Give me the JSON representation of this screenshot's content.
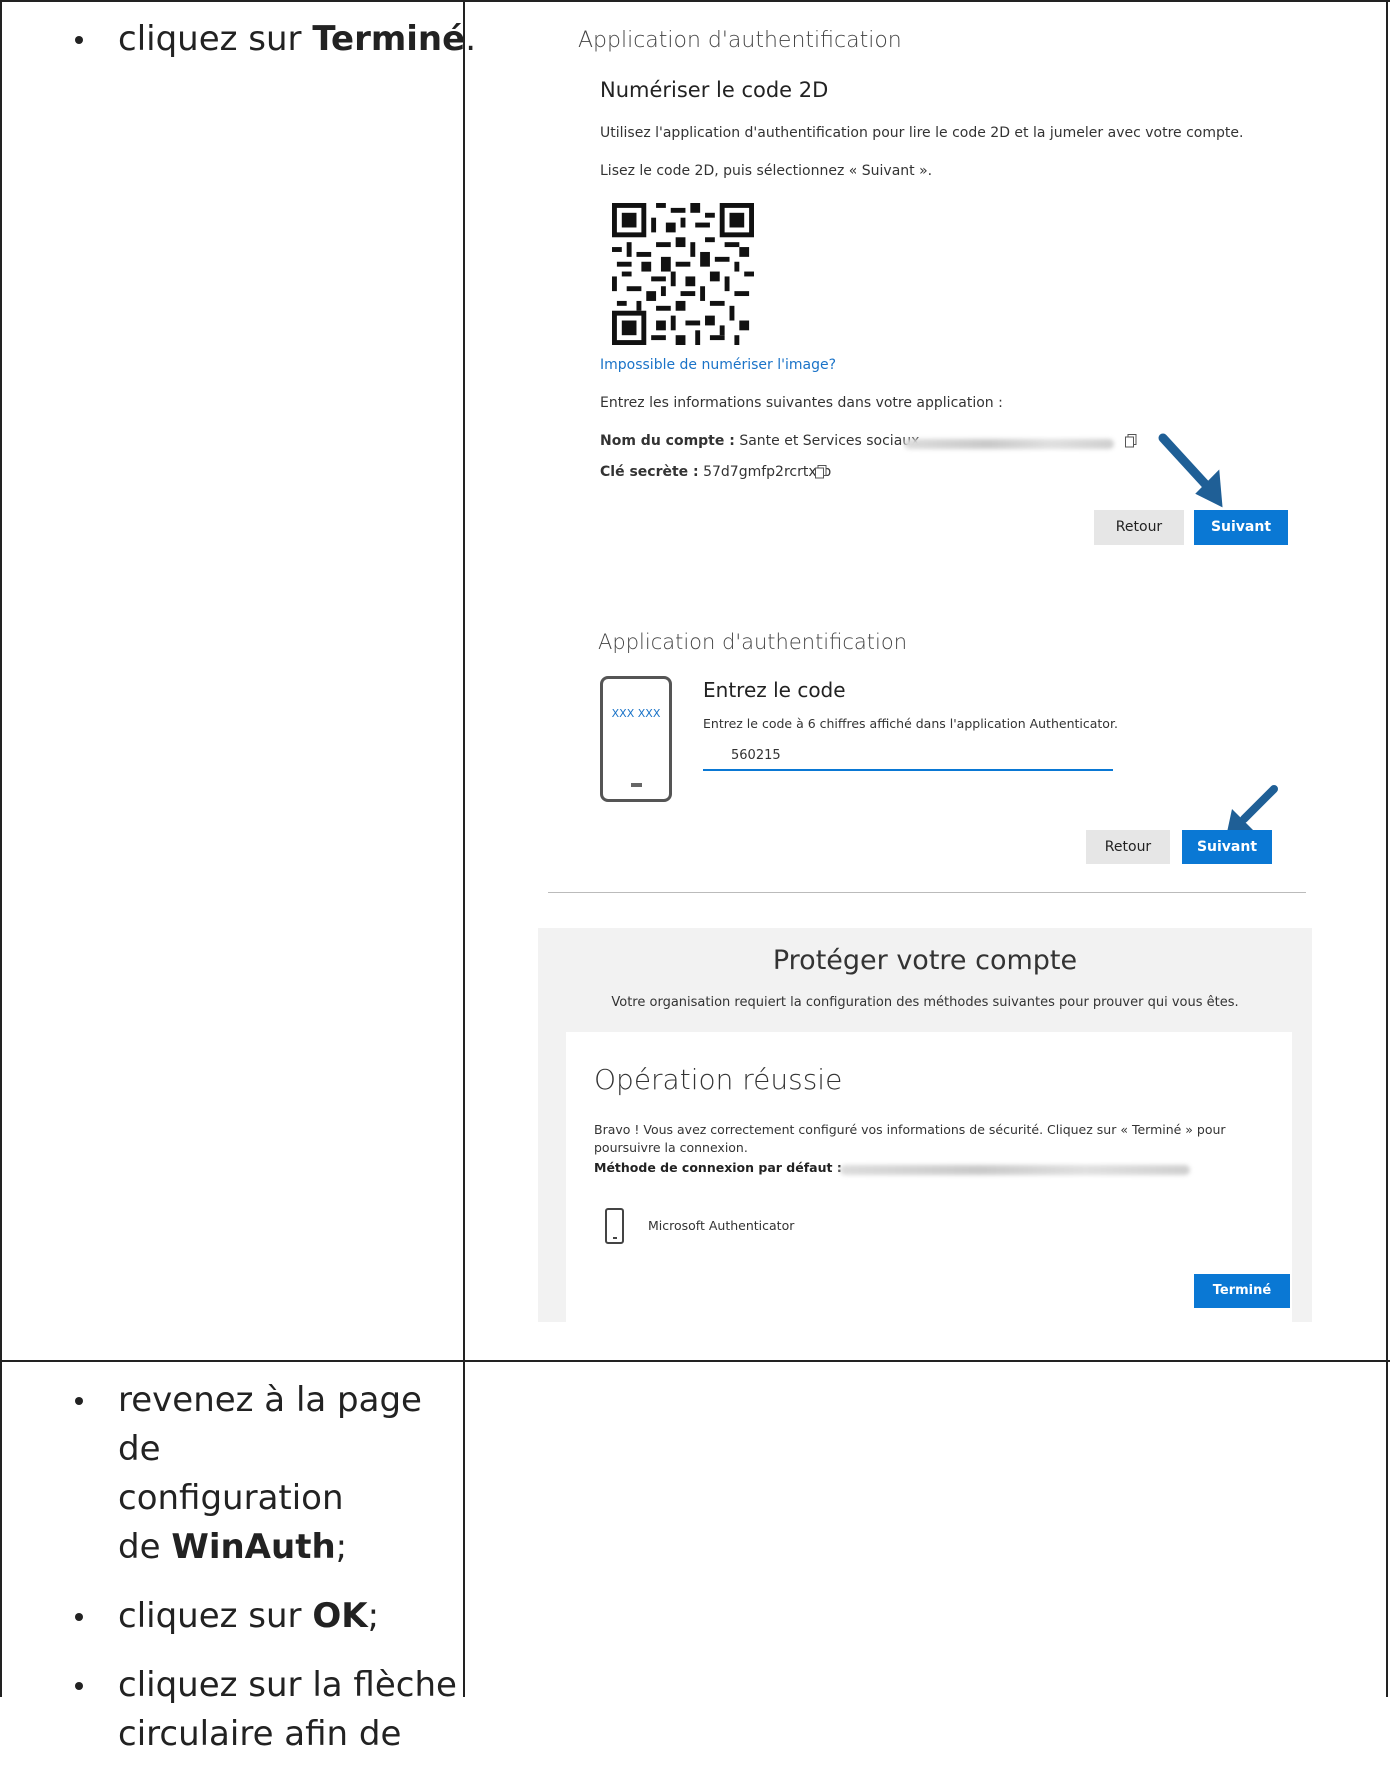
{
  "instructions_top": {
    "prefix": "cliquez sur ",
    "bold": "Terminé",
    "suffix": "."
  },
  "instructions_bottom": [
    {
      "line1": "revenez à la page de",
      "line2": "configuration",
      "line3_prefix": "de ",
      "bold": "WinAuth",
      "suffix": ";"
    },
    {
      "prefix": "cliquez sur ",
      "bold": "OK",
      "suffix": ";"
    },
    {
      "line1": "cliquez sur la flèche",
      "line2": "circulaire afin de"
    }
  ],
  "panel1": {
    "header": "Application d'authentification",
    "title": "Numériser le code 2D",
    "desc1": "Utilisez l'application d'authentification pour lire le code 2D et la jumeler avec votre compte.",
    "desc2": "Lisez le code 2D, puis sélectionnez « Suivant ».",
    "link": "Impossible de numériser l'image?",
    "info": "Entrez les informations suivantes dans votre application :",
    "account_label": "Nom du compte :",
    "account_value": "Sante et Services sociaux",
    "secret_label": "Clé secrète :",
    "secret_value": "57d7gmfp2rcrtxrb",
    "back": "Retour",
    "next": "Suivant"
  },
  "panel2": {
    "header": "Application d'authentification",
    "phone_code": "XXX XXX",
    "title": "Entrez le code",
    "desc": "Entrez le code à 6 chiffres affiché dans l'application Authenticator.",
    "code_value": "560215",
    "back": "Retour",
    "next": "Suivant"
  },
  "panel3": {
    "title": "Protéger votre compte",
    "subtitle": "Votre organisation requiert la configuration des méthodes suivantes pour prouver qui vous êtes.",
    "success": "Opération réussie",
    "text1": "Bravo ! Vous avez correctement configuré vos informations de sécurité. Cliquez sur « Terminé » pour",
    "text2": "poursuivre la connexion.",
    "default_label": "Méthode de connexion par défaut :",
    "method": "Microsoft Authenticator",
    "done": "Terminé"
  },
  "colors": {
    "accent": "#0a78d4",
    "arrow": "#1f5f96",
    "link": "#1a73c8"
  }
}
